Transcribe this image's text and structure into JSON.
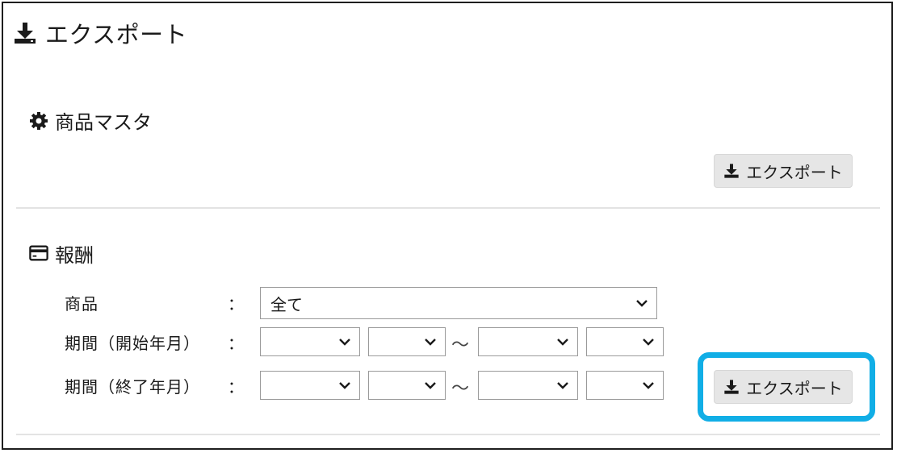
{
  "header": {
    "title": "エクスポート",
    "icon": "download-icon"
  },
  "product_master": {
    "title": "商品マスタ",
    "icon": "gear-icon",
    "export_label": "エクスポート"
  },
  "reward": {
    "title": "報酬",
    "icon": "credit-card-icon",
    "product_label": "商品",
    "colon": "：",
    "product_value": "全て",
    "start_period_label": "期間（開始年月）",
    "end_period_label": "期間（終了年月）",
    "range_separator": "～",
    "export_label": "エクスポート"
  },
  "colors": {
    "highlight": "#11aee6",
    "button_bg": "#e6e6e6"
  }
}
